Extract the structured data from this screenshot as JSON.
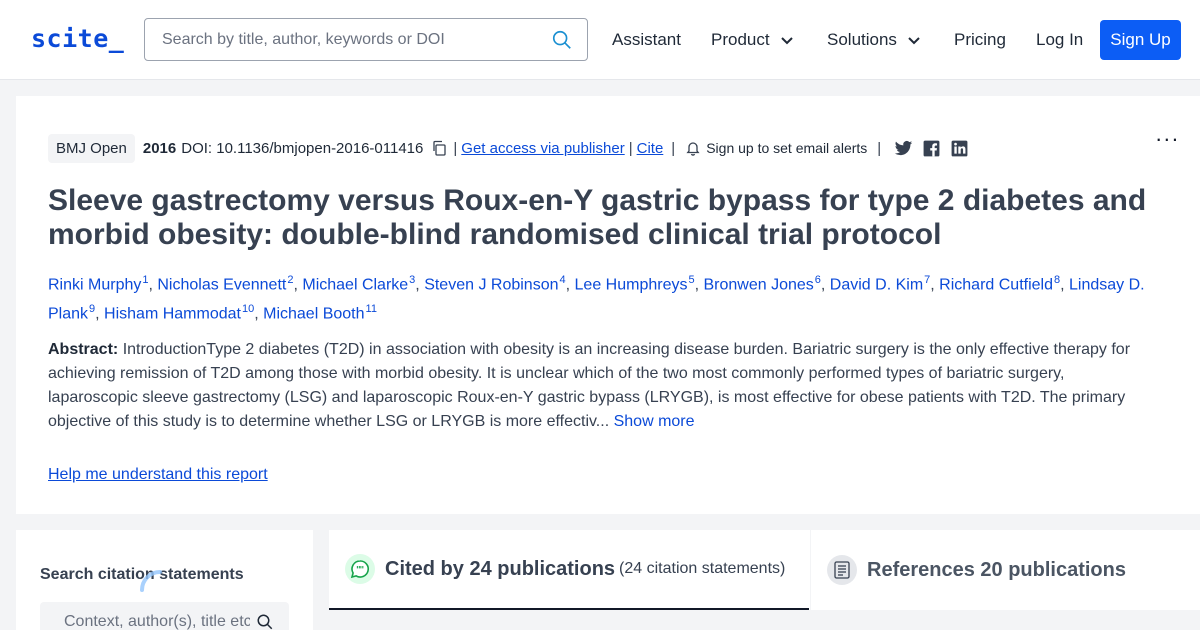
{
  "header": {
    "logo": "scite_",
    "search_placeholder": "Search by title, author, keywords or DOI",
    "nav": {
      "assistant": "Assistant",
      "product": "Product",
      "solutions": "Solutions",
      "pricing": "Pricing",
      "login": "Log In",
      "signup": "Sign Up"
    }
  },
  "paper": {
    "journal": "BMJ Open",
    "year": "2016",
    "doi": "DOI: 10.1136/bmjopen-2016-011416",
    "access_link": "Get access via publisher",
    "cite_link": "Cite",
    "alerts": "Sign up to set email alerts",
    "more": "...",
    "title": "Sleeve gastrectomy versus Roux-en-Y gastric bypass for type 2 diabetes and morbid obesity: double-blind randomised clinical trial protocol",
    "authors": [
      {
        "name": "Rinki Murphy",
        "sup": "1"
      },
      {
        "name": "Nicholas Evennett",
        "sup": "2"
      },
      {
        "name": "Michael Clarke",
        "sup": "3"
      },
      {
        "name": "Steven J Robinson",
        "sup": "4"
      },
      {
        "name": "Lee Humphreys",
        "sup": "5"
      },
      {
        "name": "Bronwen Jones",
        "sup": "6"
      },
      {
        "name": "David D. Kim",
        "sup": "7"
      },
      {
        "name": "Richard Cutfield",
        "sup": "8"
      },
      {
        "name": "Lindsay D. Plank",
        "sup": "9"
      },
      {
        "name": "Hisham Hammodat",
        "sup": "10"
      },
      {
        "name": "Michael Booth",
        "sup": "11"
      }
    ],
    "abstract_label": "Abstract:",
    "abstract_text": "IntroductionType 2 diabetes (T2D) in association with obesity is an increasing disease burden. Bariatric surgery is the only effective therapy for achieving remission of T2D among those with morbid obesity. It is unclear which of the two most commonly performed types of bariatric surgery, laparoscopic sleeve gastrectomy (LSG) and laparoscopic Roux-en-Y gastric bypass (LRYGB), is most effective for obese patients with T2D. The primary objective of this study is to determine whether LSG or LRYGB is more effectiv...",
    "show_more": "Show more",
    "help_link": "Help me understand this report"
  },
  "citation_search": {
    "title": "Search citation statements",
    "placeholder": "Context, author(s), title etc."
  },
  "tabs": {
    "cited_by": "Cited by 24 publications",
    "cited_by_sub": "(24 citation statements)",
    "references": "References 20 publications"
  },
  "icons": {
    "search": "search-icon",
    "chevron": "chevron-down-icon",
    "copy": "copy-icon",
    "bell": "bell-icon",
    "twitter": "twitter-icon",
    "facebook": "facebook-icon",
    "linkedin": "linkedin-icon",
    "quote": "quote-bubble-icon",
    "document": "document-icon"
  },
  "colors": {
    "brand": "#0b4ad8",
    "button": "#0c5df5",
    "cited_icon_bg": "#dcfce7"
  }
}
